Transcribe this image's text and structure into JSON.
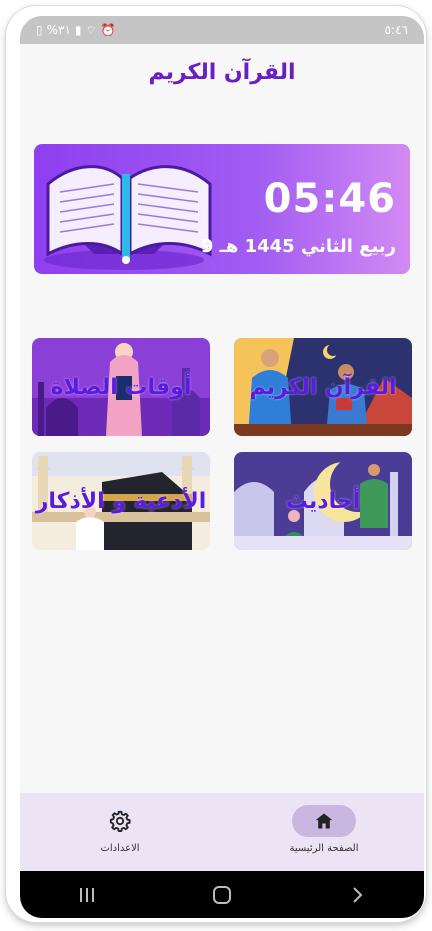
{
  "status_bar": {
    "time": "٥:٤٦",
    "battery": "٣١%"
  },
  "app_bar": {
    "title": "القرآن الكريم"
  },
  "hero": {
    "time": "05:46",
    "hijri_date": "ربيع الثاني 1445 هـ 9"
  },
  "cards": [
    {
      "label": "أوقات الصلاة"
    },
    {
      "label": "القرآن الكريم"
    },
    {
      "label": "الأدعية و الأذكار"
    },
    {
      "label": "أحاديث"
    }
  ],
  "bottom_nav": {
    "settings_label": "الاعدادات",
    "home_label": "الصفحة الرئيسية"
  },
  "colors": {
    "accent": "#6a1fc2",
    "nav_bg": "#ece4f5",
    "active_pill": "#c9b7e2"
  }
}
